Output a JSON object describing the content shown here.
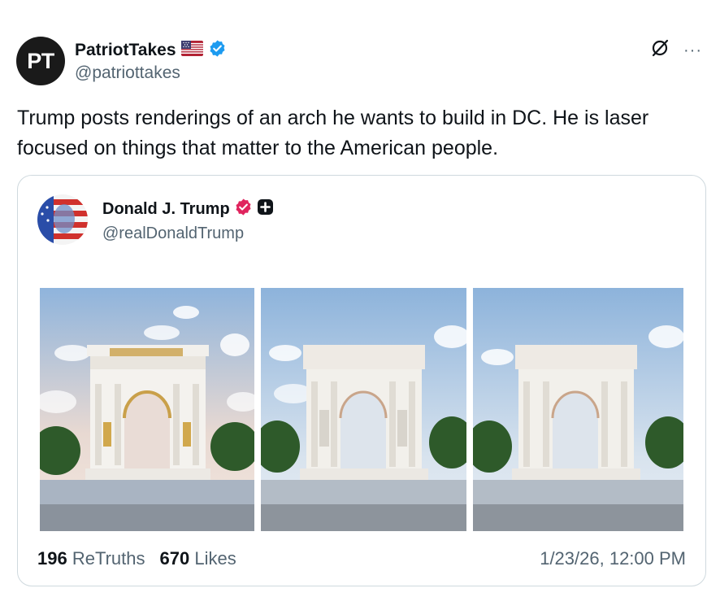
{
  "post": {
    "avatar_text": "PT",
    "display_name": "PatriotTakes",
    "handle": "@patriottakes",
    "text": "Trump posts renderings of an arch he wants to build in DC. He is laser focused on things that matter to the American people.",
    "icons": [
      "us-flag-icon",
      "verified-badge-icon",
      "no-notifications-icon",
      "more-options-icon"
    ],
    "more_label": "···"
  },
  "quoted": {
    "display_name": "Donald J. Trump",
    "handle": "@realDonaldTrump",
    "icons": [
      "verified-badge-icon",
      "plus-badge-icon"
    ],
    "images": [
      {
        "alt": "arch-rendering-gold-accents"
      },
      {
        "alt": "arch-rendering-white-statues"
      },
      {
        "alt": "arch-rendering-white-plain"
      }
    ],
    "retruths_count": "196",
    "retruths_label": "ReTruths",
    "likes_count": "670",
    "likes_label": "Likes",
    "timestamp": "1/23/26, 12:00 PM"
  },
  "colors": {
    "verified_blue": "#1d9bf0",
    "verified_pink": "#e0245e",
    "text_primary": "#0f1419",
    "text_secondary": "#536471",
    "border": "#cfd9de"
  }
}
